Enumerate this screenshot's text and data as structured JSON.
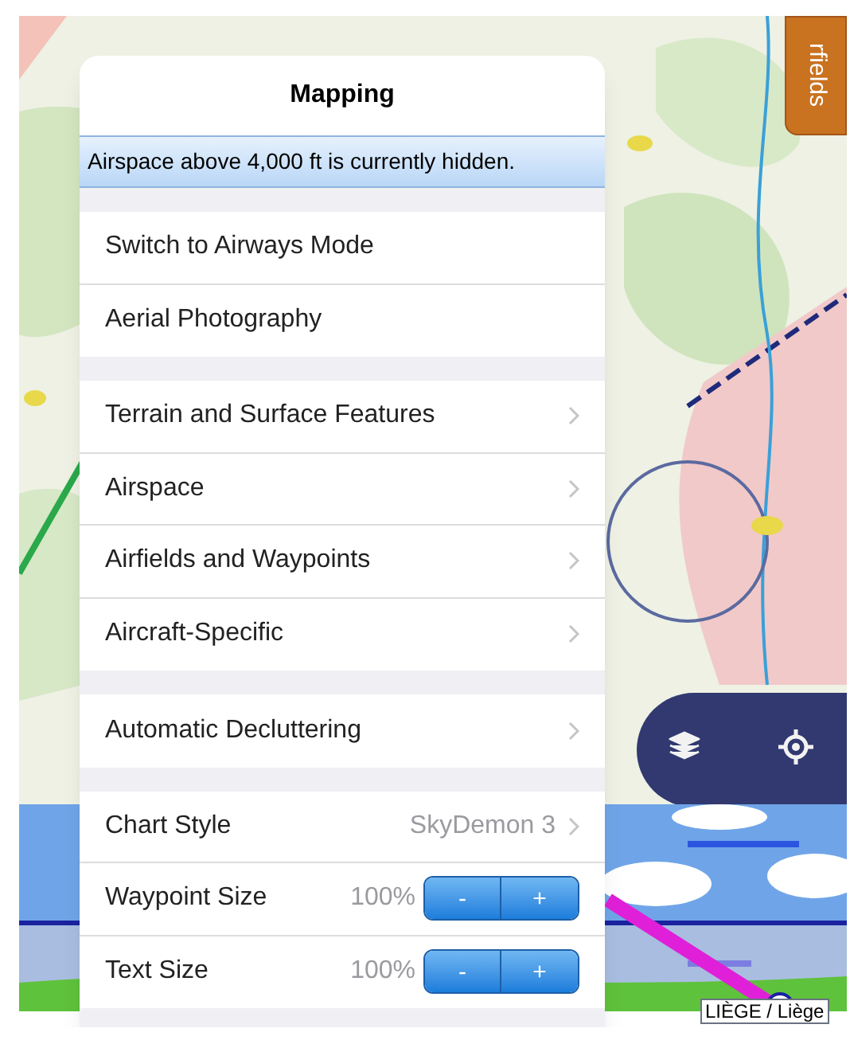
{
  "side_tab": {
    "label": "rfields"
  },
  "popover": {
    "title": "Mapping",
    "notice": "Airspace above 4,000 ft is currently hidden.",
    "sections": [
      {
        "rows": [
          {
            "kind": "action",
            "label": "Switch to Airways Mode"
          },
          {
            "kind": "action",
            "label": "Aerial Photography"
          }
        ]
      },
      {
        "rows": [
          {
            "kind": "link",
            "label": "Terrain and Surface Features"
          },
          {
            "kind": "link",
            "label": "Airspace"
          },
          {
            "kind": "link",
            "label": "Airfields and Waypoints"
          },
          {
            "kind": "link",
            "label": "Aircraft-Specific"
          }
        ]
      },
      {
        "rows": [
          {
            "kind": "link",
            "label": "Automatic Decluttering"
          }
        ]
      },
      {
        "rows": [
          {
            "kind": "link",
            "label": "Chart Style",
            "value": "SkyDemon 3"
          },
          {
            "kind": "stepper",
            "label": "Waypoint Size",
            "value": "100%",
            "minus": "-",
            "plus": "+"
          },
          {
            "kind": "stepper",
            "label": "Text Size",
            "value": "100%",
            "minus": "-",
            "plus": "+"
          }
        ]
      }
    ]
  },
  "profile": {
    "label": "LIÈGE / Liège"
  }
}
